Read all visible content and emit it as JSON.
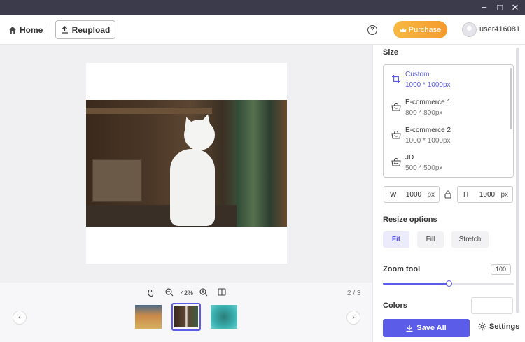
{
  "window": {
    "controls": [
      "−",
      "□",
      "✕"
    ]
  },
  "toolbar": {
    "home_label": "Home",
    "reupload_label": "Reupload",
    "purchase_label": "Purchase",
    "username": "user416081"
  },
  "canvas": {
    "zoom_percent": "42%",
    "page_count": "2 / 3"
  },
  "thumbnails": [
    {
      "name": "person-photo",
      "selected": false
    },
    {
      "name": "cat-photo",
      "selected": true
    },
    {
      "name": "sea-turtle-photo",
      "selected": false
    }
  ],
  "panel": {
    "size_title": "Size",
    "sizes": [
      {
        "name": "Custom",
        "dim": "1000 * 1000px",
        "icon": "crop-icon",
        "active": true
      },
      {
        "name": "E-commerce 1",
        "dim": "800 * 800px",
        "icon": "shopping-bag-icon",
        "active": false
      },
      {
        "name": "E-commerce 2",
        "dim": "1000 * 1000px",
        "icon": "shopping-bag-icon",
        "active": false
      },
      {
        "name": "JD",
        "dim": "500 * 500px",
        "icon": "shopping-bag-icon",
        "active": false
      }
    ],
    "width": {
      "label": "W",
      "value": "1000",
      "unit": "px"
    },
    "height": {
      "label": "H",
      "value": "1000",
      "unit": "px"
    },
    "resize_title": "Resize options",
    "resize_options": [
      {
        "label": "Fit",
        "active": true
      },
      {
        "label": "Fill",
        "active": false
      },
      {
        "label": "Stretch",
        "active": false
      }
    ],
    "zoom_title": "Zoom tool",
    "zoom_value": "100",
    "zoom_slider_fraction": 0.5,
    "colors_title": "Colors",
    "save_all_label": "Save All",
    "settings_label": "Settings"
  },
  "colors": {
    "accent": "#5b5ce8",
    "purchase_gradient_start": "#f7b942",
    "purchase_gradient_end": "#f59a2e",
    "titlebar": "#3b3b4c"
  }
}
